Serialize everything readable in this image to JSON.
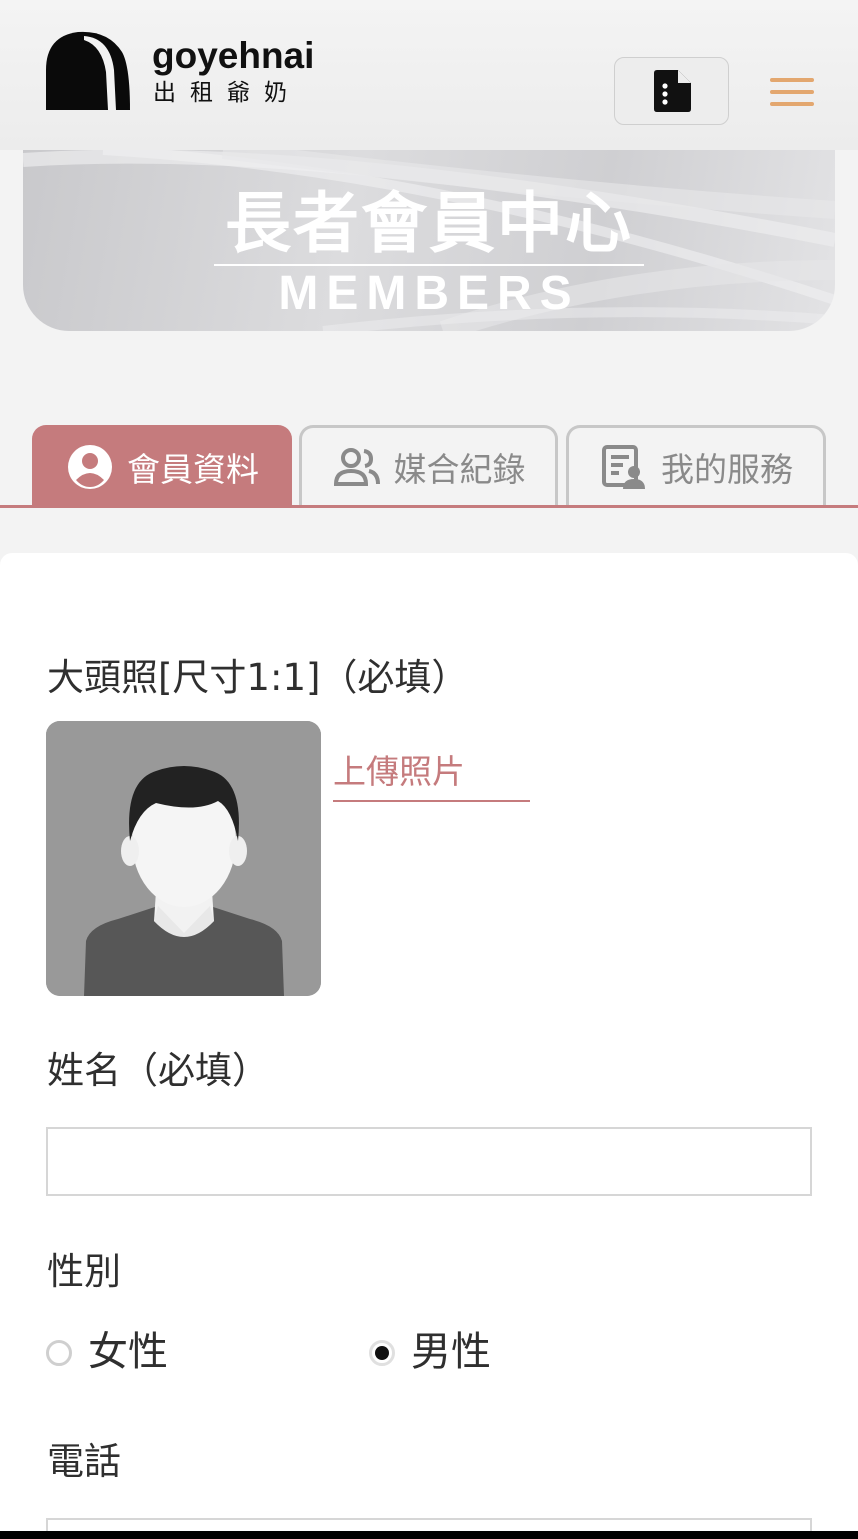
{
  "header": {
    "brand_name": "goyehnai",
    "brand_sub": "出租爺奶",
    "doc_icon": "file-icon",
    "menu_icon": "hamburger-icon",
    "menu_color": "#e3a76f"
  },
  "banner": {
    "title": "長者會員中心",
    "subtitle": "MEMBERS"
  },
  "tabs": [
    {
      "label": "會員資料",
      "icon": "user-circle-icon",
      "active": true
    },
    {
      "label": "媒合紀錄",
      "icon": "users-icon",
      "active": false
    },
    {
      "label": "我的服務",
      "icon": "service-list-icon",
      "active": false
    }
  ],
  "accent_color": "#c57b7d",
  "form": {
    "photo_label": "大頭照[尺寸1:1]（必填）",
    "upload_label": "上傳照片",
    "name_label": "姓名（必填）",
    "name_value": "",
    "gender_label": "性別",
    "gender_options": [
      "女性",
      "男性"
    ],
    "gender_selected": "男性",
    "phone_label": "電話",
    "phone_value": ""
  }
}
